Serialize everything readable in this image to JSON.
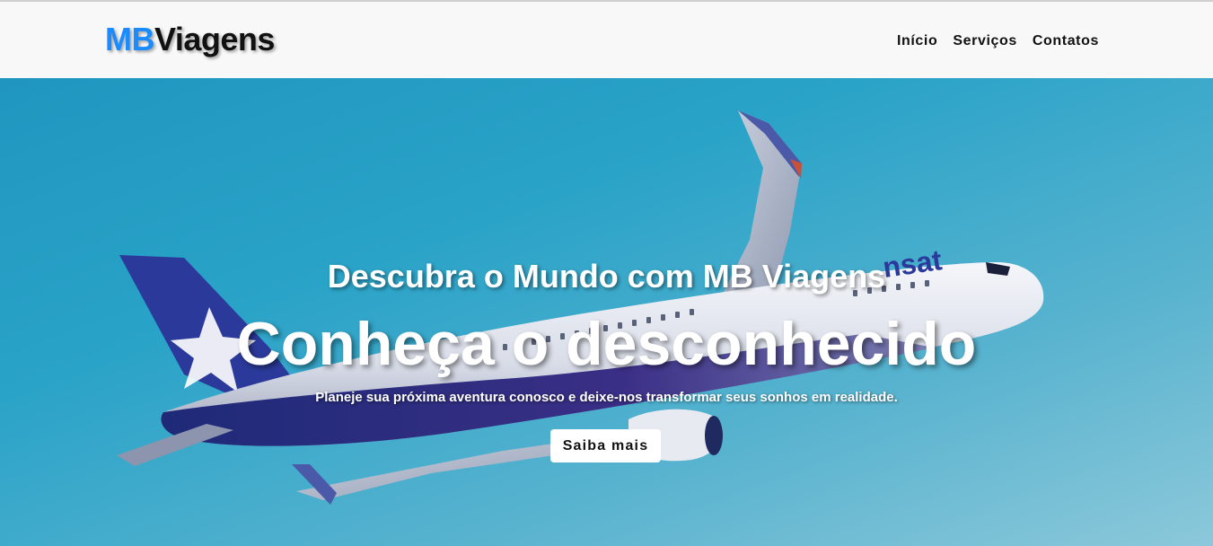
{
  "header": {
    "logo": {
      "part1": "MB",
      "part2": "Viagens"
    },
    "nav": [
      {
        "label": "Início"
      },
      {
        "label": "Serviços"
      },
      {
        "label": "Contatos"
      }
    ]
  },
  "hero": {
    "subtitle": "Descubra o Mundo com MB Viagens",
    "title": "Conheça o desconhecido",
    "tagline": "Planeje sua próxima aventura conosco e deixe-nos transformar seus sonhos em realidade.",
    "cta_label": "Saiba mais",
    "background_image": "airplane-in-sky",
    "plane_livery_text": "nsat"
  },
  "colors": {
    "logo_accent": "#1a8cff",
    "logo_text": "#111111",
    "header_bg": "#f8f8f8",
    "sky": "#2aa3c8",
    "hero_text": "#ffffff"
  }
}
